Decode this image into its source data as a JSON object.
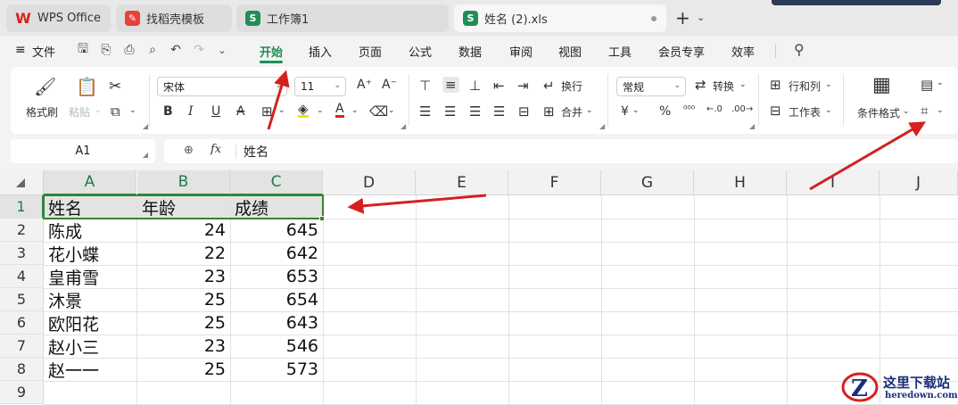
{
  "tabs": [
    {
      "label": "WPS Office",
      "icon": "wps-logo-icon"
    },
    {
      "label": "找稻壳模板",
      "icon": "docer-icon"
    },
    {
      "label": "工作簿1",
      "icon": "spreadsheet-icon"
    },
    {
      "label": "姓名 (2).xls",
      "icon": "spreadsheet-icon",
      "active": true
    }
  ],
  "tab_icon_letter": "S",
  "menu": {
    "file": "文件",
    "tabs": [
      "开始",
      "插入",
      "页面",
      "公式",
      "数据",
      "审阅",
      "视图",
      "工具",
      "会员专享",
      "效率"
    ],
    "active": "开始"
  },
  "ribbon": {
    "format_painter": "格式刷",
    "paste": "粘贴",
    "font_name": "宋体",
    "font_size": "11",
    "wrap": "换行",
    "merge": "合并",
    "number_format": "常规",
    "convert": "转换",
    "rows_cols": "行和列",
    "worksheet": "工作表",
    "conditional_format": "条件格式",
    "currency_symbol": "¥",
    "percent_symbol": "%",
    "bold": "B",
    "italic": "I",
    "underline": "U",
    "strike": "A"
  },
  "formula_bar": {
    "cell_ref": "A1",
    "fx": "fx",
    "content": "姓名"
  },
  "grid": {
    "columns": [
      "A",
      "B",
      "C",
      "D",
      "E",
      "F",
      "G",
      "H",
      "I",
      "J"
    ],
    "rows": [
      "1",
      "2",
      "3",
      "4",
      "5",
      "6",
      "7",
      "8",
      "9"
    ],
    "headers": [
      "姓名",
      "年龄",
      "成绩"
    ],
    "data": [
      [
        "陈成",
        "24",
        "645"
      ],
      [
        "花小蝶",
        "22",
        "642"
      ],
      [
        "皇甫雪",
        "23",
        "653"
      ],
      [
        "沐景",
        "25",
        "654"
      ],
      [
        "欧阳花",
        "25",
        "643"
      ],
      [
        "赵小三",
        "23",
        "546"
      ],
      [
        "赵一一",
        "25",
        "573"
      ]
    ]
  },
  "watermark": {
    "title": "这里下载站",
    "url": "heredown.com"
  },
  "colors": {
    "accent": "#1f8f55",
    "annotation": "#d42020",
    "selection_border": "#3f7f2f"
  }
}
